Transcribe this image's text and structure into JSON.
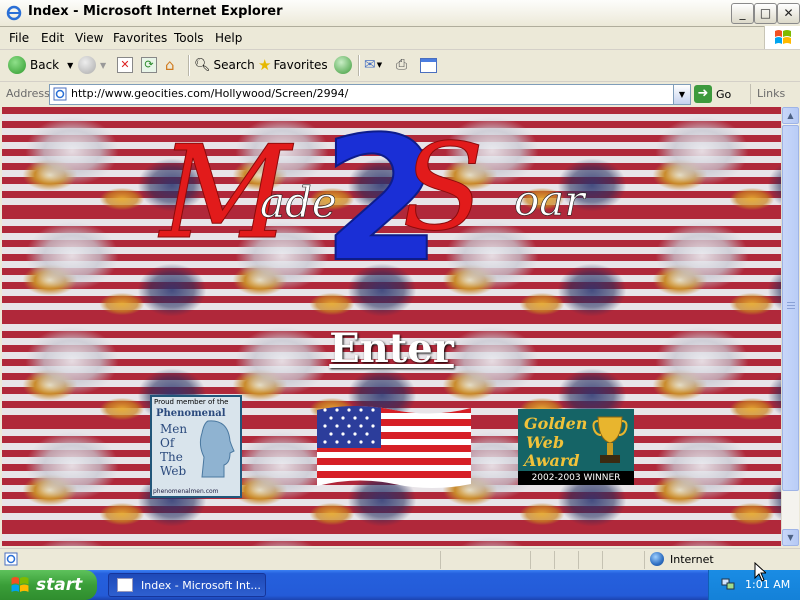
{
  "window": {
    "title": "Index - Microsoft Internet Explorer",
    "controls": {
      "minimize": "_",
      "maximize": "□",
      "close": "✕"
    }
  },
  "menu": [
    "File",
    "Edit",
    "View",
    "Favorites",
    "Tools",
    "Help"
  ],
  "toolbar": {
    "back_label": "Back",
    "search_label": "Search",
    "favorites_label": "Favorites"
  },
  "address": {
    "label": "Address",
    "url": "http://www.geocities.com/Hollywood/Screen/2994/",
    "go_label": "Go",
    "links_label": "Links"
  },
  "page": {
    "logo_text": {
      "m": "M",
      "ade": "ade",
      "two": "2",
      "s": "S",
      "oar": "oar"
    },
    "enter_label": "Enter",
    "award_phenomenal": {
      "header": "Proud member of the",
      "lines": [
        "Phenomenal",
        "Men",
        "Of",
        "The",
        "Web"
      ],
      "footer": "phenomenalmen.com"
    },
    "award_golden": {
      "line1": "Golden",
      "line2": "Web",
      "line3": "Award",
      "caption": "2002-2003 WINNER"
    }
  },
  "statusbar": {
    "zone_label": "Internet"
  },
  "taskbar": {
    "start_label": "start",
    "task_label": "Index - Microsoft Int...",
    "clock": "1:01 AM"
  },
  "colors": {
    "logo_red": "#e21b1b",
    "logo_blue": "#1a2fd6",
    "xp_taskbar": "#245bd8",
    "start_green": "#3a9e38"
  }
}
